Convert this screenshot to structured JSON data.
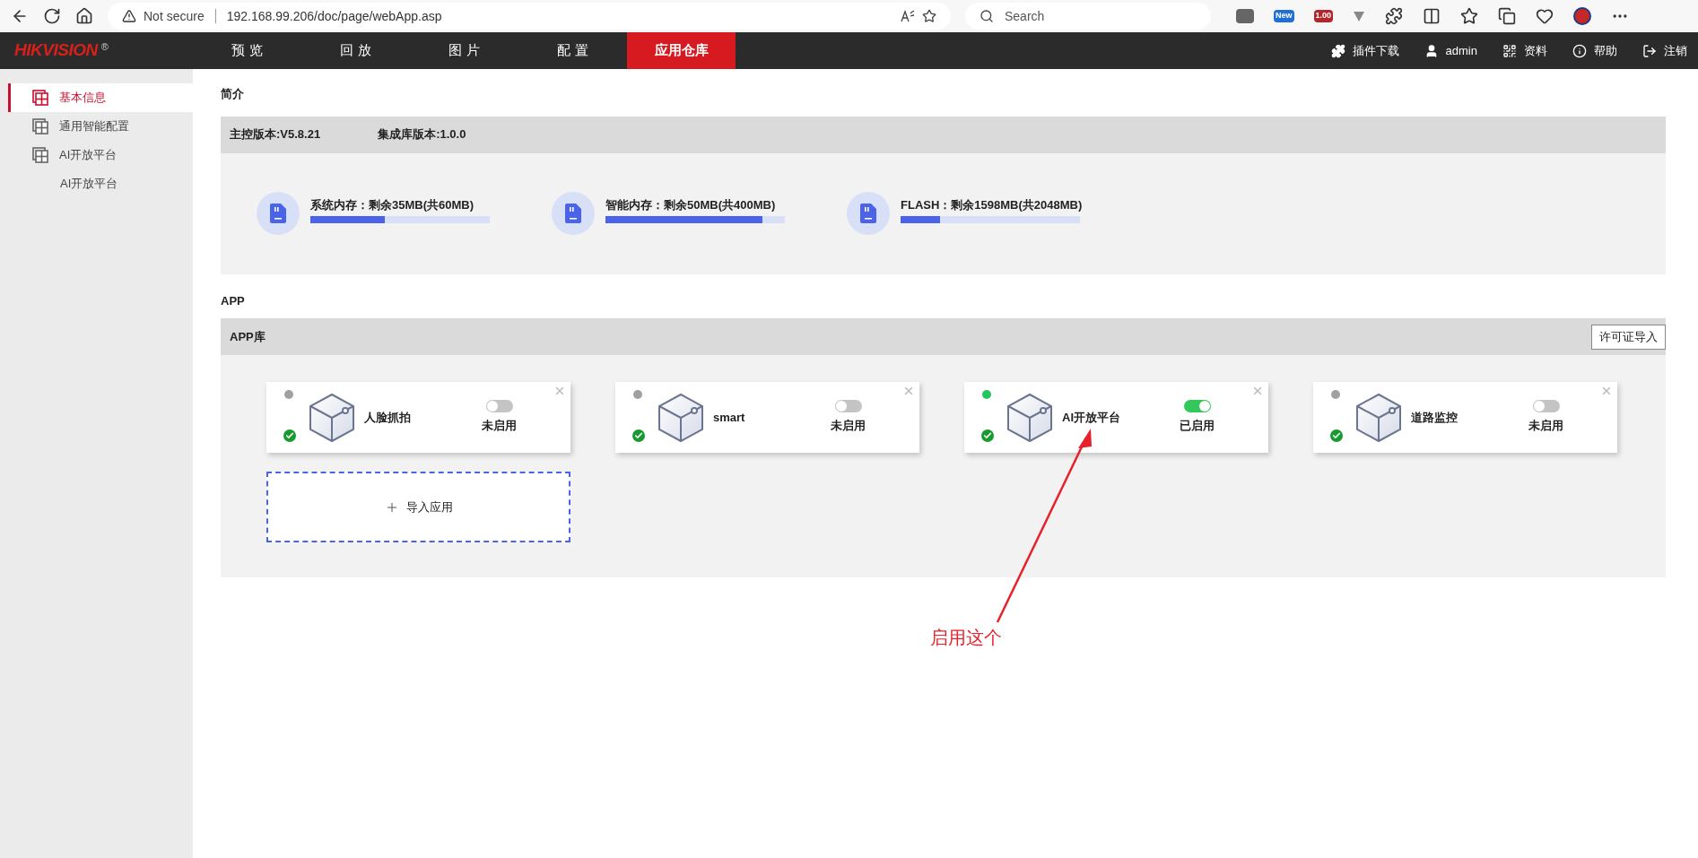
{
  "browser": {
    "security": "Not secure",
    "url": "192.168.99.206/doc/page/webApp.asp",
    "search_placeholder": "Search",
    "badges": [
      "New",
      "1.00"
    ]
  },
  "header": {
    "logo": "HIKVISION",
    "logo_mark": "®",
    "nav": [
      {
        "label": "预 览",
        "selected": false
      },
      {
        "label": "回 放",
        "selected": false
      },
      {
        "label": "图 片",
        "selected": false
      },
      {
        "label": "配 置",
        "selected": false
      },
      {
        "label": "应用仓库",
        "selected": true
      }
    ],
    "tools": [
      {
        "kind": "plugin",
        "label": "插件下载"
      },
      {
        "kind": "user",
        "label": "admin"
      },
      {
        "kind": "qr",
        "label": "资料"
      },
      {
        "kind": "help",
        "label": "帮助"
      },
      {
        "kind": "logout",
        "label": "注销"
      }
    ]
  },
  "sidebar": {
    "items": [
      {
        "label": "基本信息",
        "selected": true
      },
      {
        "label": "通用智能配置",
        "selected": false
      },
      {
        "label": "AI开放平台",
        "selected": false,
        "children": [
          {
            "label": "AI开放平台",
            "selected": false
          }
        ]
      }
    ]
  },
  "intro": {
    "title": "简介",
    "versions": [
      "主控版本:V5.8.21",
      "集成库版本:1.0.0"
    ],
    "storage": [
      {
        "label": "系统内存：剩余35MB(共60MB)",
        "level": 0.415
      },
      {
        "label": "智能内存：剩余50MB(共400MB)",
        "level": 0.875
      },
      {
        "label": "FLASH：剩余1598MB(共2048MB)",
        "level": 0.22
      }
    ]
  },
  "app": {
    "title": "APP",
    "library_title": "APP库",
    "license_button": "许可证导入",
    "apps": [
      {
        "name": "人脸抓拍",
        "color": "#a0a0a0",
        "on": false,
        "status": "未启用"
      },
      {
        "name": "smart",
        "color": "#a0a0a0",
        "on": false,
        "status": "未启用"
      },
      {
        "name": "AI开放平台",
        "color": "#22c55e",
        "on": true,
        "status": "已启用"
      },
      {
        "name": "道路监控",
        "color": "#a0a0a0",
        "on": false,
        "status": "未启用"
      }
    ],
    "import_button": "导入应用"
  },
  "annotation": {
    "text": "启用这个"
  }
}
